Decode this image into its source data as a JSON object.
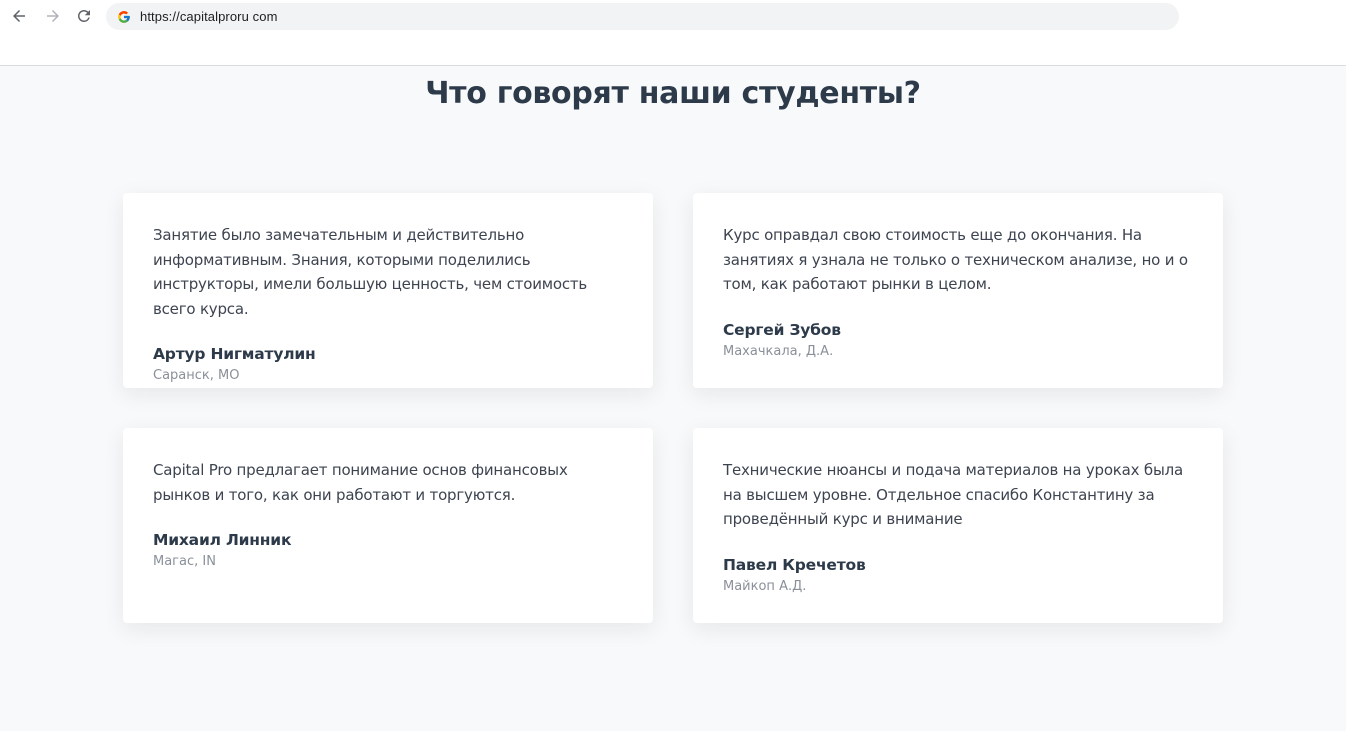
{
  "browser": {
    "url": "https://capitalproru com",
    "back_icon": "arrow-left-icon",
    "forward_icon": "arrow-right-icon",
    "reload_icon": "reload-icon",
    "site_icon": "google-g-icon"
  },
  "section": {
    "title": "Что говорят наши студенты?"
  },
  "testimonials": [
    {
      "quote": "Занятие было замечательным и действительно информативным. Знания, которыми поделились инструкторы, имели большую ценность, чем стоимость всего курса.",
      "name": "Артур Нигматулин",
      "city": "Саранск, МО"
    },
    {
      "quote": "Курс оправдал свою стоимость еще до окончания. На занятиях я узнала не только о техническом анализе, но и о том, как работают рынки в целом.",
      "name": "Сергей Зубов",
      "city": "Махачкала, Д.А."
    },
    {
      "quote": "Capital Pro предлагает понимание основ финансовых рынков и того, как они работают и торгуются.",
      "name": "Михаил Линник",
      "city": "Магас, IN"
    },
    {
      "quote": "Технические нюансы и подача материалов на уроках была на высшем уровне. Отдельное спасибо Константину за проведённый курс и внимание",
      "name": "Павел Кречетов",
      "city": "Майкоп А.Д."
    }
  ],
  "colors": {
    "page_bg": "#f8f9fa",
    "card_bg": "#ffffff",
    "heading": "#2d3a4a",
    "body_text": "#3d4450",
    "muted_text": "#8a9099"
  }
}
